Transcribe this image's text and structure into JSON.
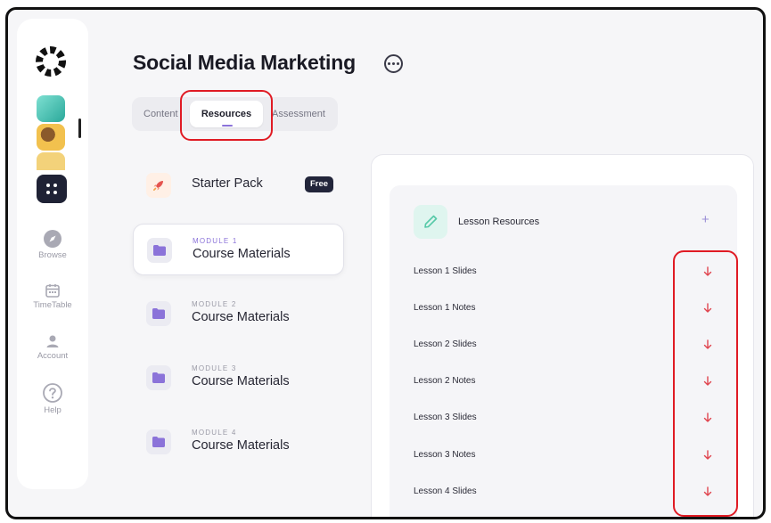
{
  "course": {
    "title": "Social Media Marketing"
  },
  "tabs": [
    {
      "label": "Content"
    },
    {
      "label": "Resources"
    },
    {
      "label": "Assessment"
    }
  ],
  "sidebar": {
    "nav": [
      {
        "label": "Browse",
        "icon": "compass-icon"
      },
      {
        "label": "TimeTable",
        "icon": "calendar-icon"
      },
      {
        "label": "Account",
        "icon": "user-icon"
      },
      {
        "label": "Help",
        "icon": "help-icon"
      }
    ]
  },
  "modules": {
    "starter": {
      "name": "Starter Pack",
      "badge": "Free"
    },
    "items": [
      {
        "label": "MODULE 1",
        "name": "Course Materials"
      },
      {
        "label": "MODULE 2",
        "name": "Course Materials"
      },
      {
        "label": "MODULE 3",
        "name": "Course Materials"
      },
      {
        "label": "MODULE 4",
        "name": "Course Materials"
      }
    ]
  },
  "resources": {
    "title": "Lesson Resources",
    "add_symbol": "+",
    "items": [
      {
        "label": "Lesson 1 Slides"
      },
      {
        "label": "Lesson 1 Notes"
      },
      {
        "label": "Lesson 2 Slides"
      },
      {
        "label": "Lesson 2 Notes"
      },
      {
        "label": "Lesson 3 Slides"
      },
      {
        "label": "Lesson 3 Notes"
      },
      {
        "label": "Lesson 4 Slides"
      }
    ]
  },
  "colors": {
    "accent": "#8b73d9",
    "download": "#e0454f",
    "highlight": "#e01b24",
    "dark": "#1f2235"
  }
}
